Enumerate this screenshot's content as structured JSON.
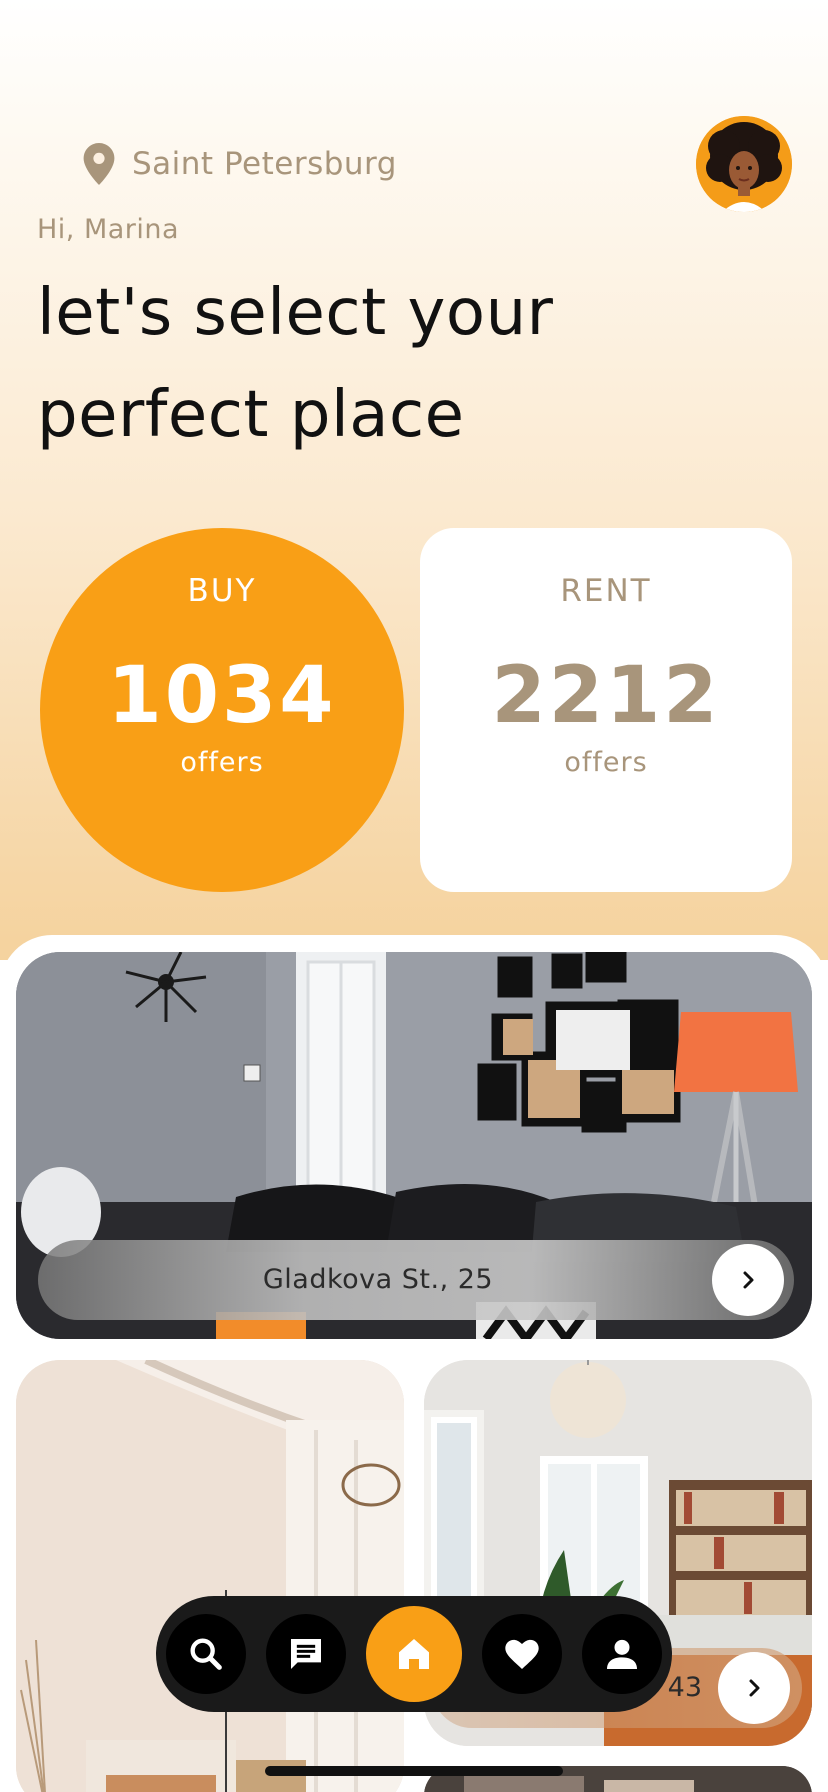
{
  "header": {
    "location": "Saint Petersburg",
    "greeting": "Hi, Marina",
    "headline_line1": "let's select your",
    "headline_line2": "perfect place"
  },
  "stats": {
    "buy": {
      "label": "BUY",
      "count": "1034",
      "sub": "offers"
    },
    "rent": {
      "label": "RENT",
      "count": "2212",
      "sub": "offers"
    }
  },
  "listings": [
    {
      "address": "Gladkova St., 25"
    },
    {
      "address": ""
    },
    {
      "address": "43"
    }
  ],
  "nav": {
    "items": [
      "search-icon",
      "chat-icon",
      "home-icon",
      "heart-icon",
      "profile-icon"
    ],
    "active": "home-icon"
  },
  "colors": {
    "accent": "#f99f16",
    "muted_text": "#a8957b",
    "nav_bg": "#1a1a1a"
  }
}
